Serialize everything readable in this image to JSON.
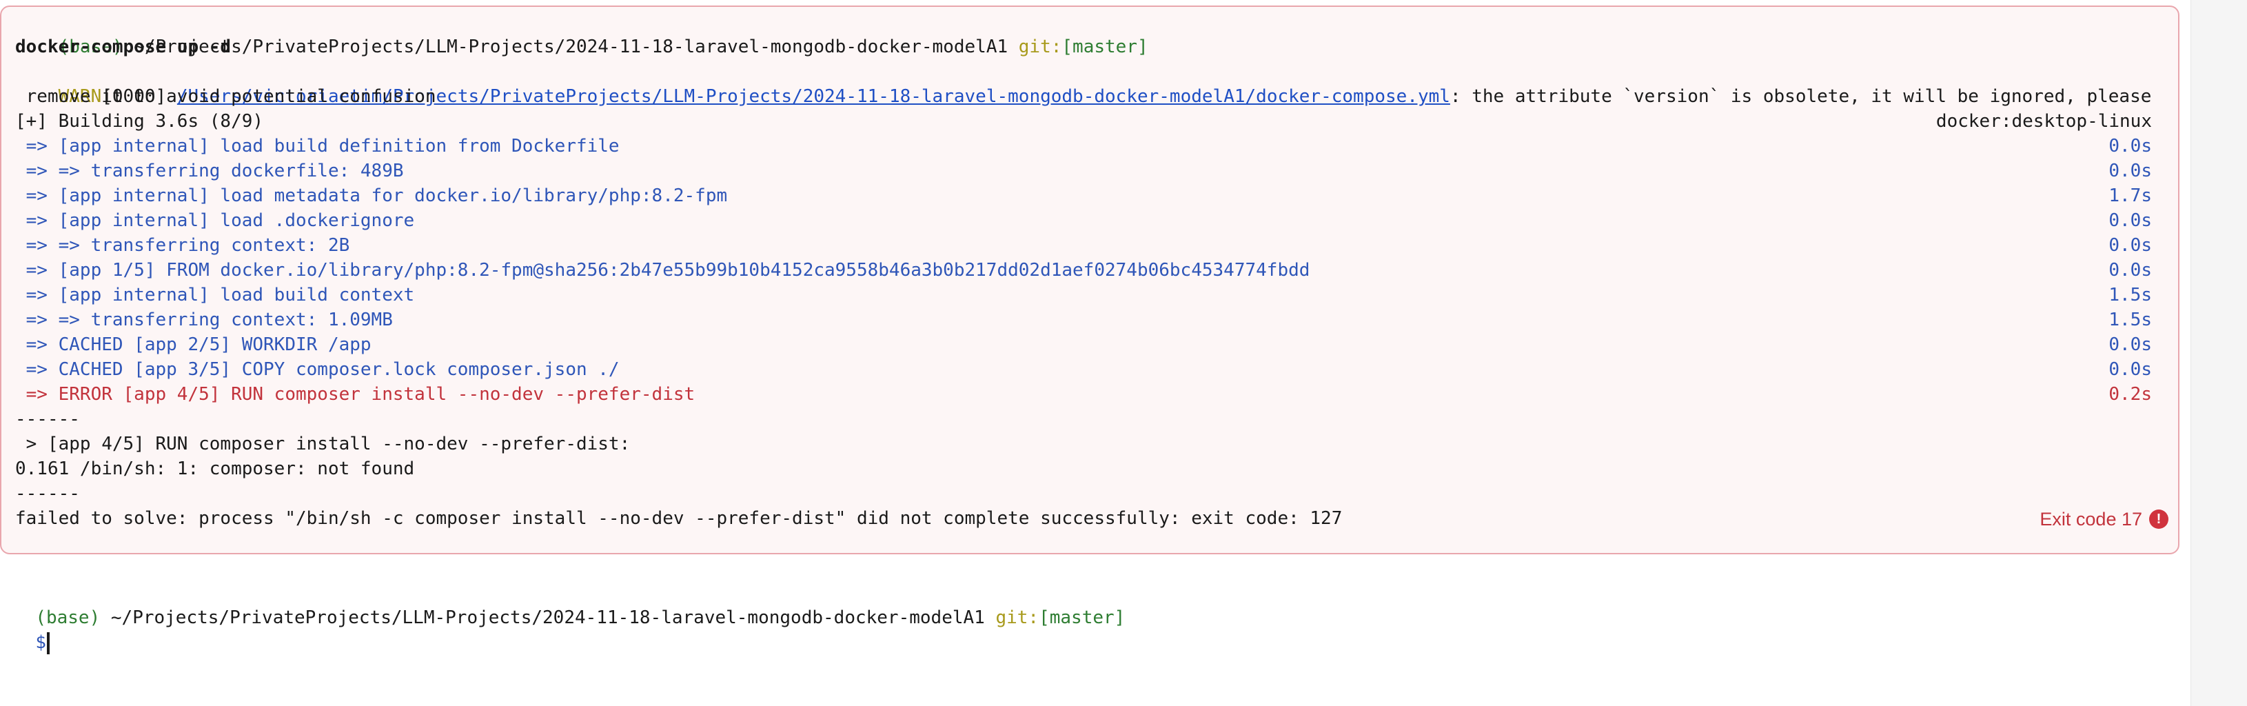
{
  "block1": {
    "prompt": {
      "env": "(base)",
      "path": " ~/Projects/PrivateProjects/LLM-Projects/2024-11-18-laravel-mongodb-docker-modelA1 ",
      "git_label": "git:",
      "branch": "[master]"
    },
    "command": "docker-compose up -d",
    "warn": {
      "label": "WARN",
      "code": "[0000] ",
      "file": "/Users/victoriaetim/Projects/PrivateProjects/LLM-Projects/2024-11-18-laravel-mongodb-docker-modelA1/docker-compose.yml",
      "message": ": the attribute `version` is obsolete, it will be ignored, please",
      "message_cont": " remove it to avoid potential confusion"
    },
    "building": {
      "label": "[+] Building 3.6s (8/9)",
      "context": "docker:desktop-linux"
    },
    "steps": [
      {
        "text": " => [app internal] load build definition from Dockerfile",
        "time": "0.0s",
        "status": "ok"
      },
      {
        "text": " => => transferring dockerfile: 489B",
        "time": "0.0s",
        "status": "ok"
      },
      {
        "text": " => [app internal] load metadata for docker.io/library/php:8.2-fpm",
        "time": "1.7s",
        "status": "ok"
      },
      {
        "text": " => [app internal] load .dockerignore",
        "time": "0.0s",
        "status": "ok"
      },
      {
        "text": " => => transferring context: 2B",
        "time": "0.0s",
        "status": "ok"
      },
      {
        "text": " => [app 1/5] FROM docker.io/library/php:8.2-fpm@sha256:2b47e55b99b10b4152ca9558b46a3b0b217dd02d1aef0274b06bc4534774fbdd",
        "time": "0.0s",
        "status": "ok"
      },
      {
        "text": " => [app internal] load build context",
        "time": "1.5s",
        "status": "ok"
      },
      {
        "text": " => => transferring context: 1.09MB",
        "time": "1.5s",
        "status": "ok"
      },
      {
        "text": " => CACHED [app 2/5] WORKDIR /app",
        "time": "0.0s",
        "status": "ok"
      },
      {
        "text": " => CACHED [app 3/5] COPY composer.lock composer.json ./",
        "time": "0.0s",
        "status": "ok"
      },
      {
        "text": " => ERROR [app 4/5] RUN composer install --no-dev --prefer-dist",
        "time": "0.2s",
        "status": "error"
      }
    ],
    "divider1": "------",
    "run_line": " > [app 4/5] RUN composer install --no-dev --prefer-dist:",
    "error_out": "0.161 /bin/sh: 1: composer: not found",
    "divider2": "------",
    "failed": "failed to solve: process \"/bin/sh -c composer install --no-dev --prefer-dist\" did not complete successfully: exit code: 127",
    "exit_label": "Exit code 17",
    "exit_icon": "!"
  },
  "block2": {
    "prompt": {
      "env": "(base)",
      "path": " ~/Projects/PrivateProjects/LLM-Projects/2024-11-18-laravel-mongodb-docker-modelA1 ",
      "git_label": "git:",
      "branch": "[master]"
    },
    "input_symbol": "$"
  }
}
